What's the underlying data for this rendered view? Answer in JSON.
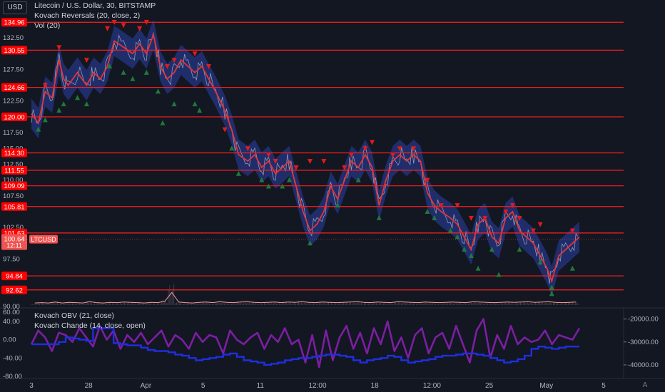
{
  "header": {
    "currency_button": "USD",
    "title": "Litecoin / U.S. Dollar, 30, BITSTAMP",
    "indicator_1": "Kovach Reversals (20, close, 2)",
    "indicator_2": "Vol (20)",
    "lower_indicator_1": "Kovach OBV (21, close)",
    "lower_indicator_2": "Kovach Chande (14, close, open)",
    "auto_button": "A"
  },
  "colors": {
    "background": "#131722",
    "level_line": "#ff1e1e",
    "level_label_bg": "#ff0000",
    "band": "#2a3fa8",
    "ma_line": "#e0363c",
    "price": "#b2b5be",
    "up_marker": "#1e7a3a",
    "down_marker": "#e01b1b",
    "chande": "#7b1fa2",
    "obv": "#1f2fe0",
    "price_label_bg": "#f05350"
  },
  "chart_data": [
    {
      "type": "line",
      "symbol": "LTCUSD",
      "last_price": "100.64",
      "countdown": "12:11",
      "x_tick_labels": [
        "3",
        "28",
        "Apr",
        "5",
        "11",
        "12:00",
        "18",
        "12:00",
        "25",
        "May",
        "5"
      ],
      "y_tick_labels": [
        "132.50",
        "127.50",
        "122.50",
        "117.50",
        "115.00",
        "112.50",
        "110.00",
        "107.50",
        "102.50",
        "97.50",
        "90.00"
      ],
      "ylim": [
        90,
        136
      ],
      "levels": [
        "134.96",
        "130.55",
        "124.66",
        "120.00",
        "114.30",
        "111.55",
        "109.09",
        "105.81",
        "101.63",
        "94.84",
        "92.62"
      ],
      "price_path": [
        [
          0,
          120.5
        ],
        [
          3,
          119
        ],
        [
          6,
          124
        ],
        [
          9,
          123
        ],
        [
          12,
          129
        ],
        [
          14,
          126
        ],
        [
          16,
          125
        ],
        [
          20,
          127
        ],
        [
          24,
          125
        ],
        [
          27,
          127
        ],
        [
          30,
          126
        ],
        [
          33,
          128
        ],
        [
          36,
          132
        ],
        [
          40,
          131
        ],
        [
          44,
          130
        ],
        [
          47,
          131.5
        ],
        [
          50,
          130
        ],
        [
          53,
          133
        ],
        [
          56,
          128
        ],
        [
          59,
          126
        ],
        [
          62,
          127
        ],
        [
          65,
          129
        ],
        [
          68,
          128
        ],
        [
          71,
          127
        ],
        [
          74,
          128
        ],
        [
          77,
          126
        ],
        [
          80,
          124
        ],
        [
          84,
          121
        ],
        [
          87,
          118
        ],
        [
          90,
          114
        ],
        [
          94,
          113
        ],
        [
          97,
          114
        ],
        [
          100,
          112
        ],
        [
          103,
          113
        ],
        [
          106,
          111
        ],
        [
          109,
          112
        ],
        [
          112,
          113
        ],
        [
          115,
          109
        ],
        [
          118,
          105
        ],
        [
          121,
          102
        ],
        [
          124,
          103
        ],
        [
          127,
          105
        ],
        [
          130,
          109
        ],
        [
          133,
          107
        ],
        [
          136,
          110
        ],
        [
          139,
          113
        ],
        [
          142,
          112
        ],
        [
          145,
          114
        ],
        [
          148,
          112
        ],
        [
          151,
          106
        ],
        [
          154,
          110
        ],
        [
          157,
          113
        ],
        [
          160,
          114
        ],
        [
          163,
          113
        ],
        [
          166,
          114
        ],
        [
          169,
          113
        ],
        [
          172,
          108
        ],
        [
          175,
          106
        ],
        [
          178,
          105
        ],
        [
          182,
          104
        ],
        [
          185,
          103
        ],
        [
          188,
          101
        ],
        [
          191,
          99
        ],
        [
          194,
          103
        ],
        [
          197,
          104
        ],
        [
          200,
          101
        ],
        [
          203,
          100
        ],
        [
          206,
          104
        ],
        [
          209,
          105
        ],
        [
          212,
          102
        ],
        [
          215,
          101
        ],
        [
          218,
          100
        ],
        [
          221,
          98
        ],
        [
          224,
          96
        ],
        [
          226,
          94
        ],
        [
          229,
          98
        ],
        [
          232,
          99
        ],
        [
          235,
          100
        ],
        [
          238,
          101
        ]
      ],
      "band_offset": 2.4,
      "up_markers": [
        [
          3,
          118
        ],
        [
          6,
          119.5
        ],
        [
          12,
          121
        ],
        [
          14,
          122
        ],
        [
          20,
          123
        ],
        [
          24,
          122
        ],
        [
          34,
          128
        ],
        [
          40,
          127
        ],
        [
          44,
          126
        ],
        [
          50,
          127
        ],
        [
          55,
          124
        ],
        [
          57,
          119
        ],
        [
          62,
          122
        ],
        [
          71,
          122
        ],
        [
          73,
          121
        ],
        [
          87,
          115
        ],
        [
          90,
          111
        ],
        [
          100,
          110
        ],
        [
          103,
          109
        ],
        [
          109,
          109
        ],
        [
          112,
          110
        ],
        [
          121,
          100
        ],
        [
          133,
          106
        ],
        [
          142,
          110
        ],
        [
          151,
          104
        ],
        [
          172,
          105
        ],
        [
          175,
          104
        ],
        [
          182,
          102
        ],
        [
          185,
          101
        ],
        [
          188,
          99
        ],
        [
          191,
          98
        ],
        [
          194,
          96
        ],
        [
          200,
          99
        ],
        [
          203,
          95
        ],
        [
          212,
          99
        ],
        [
          221,
          97
        ],
        [
          226,
          93
        ],
        [
          226,
          92
        ],
        [
          235,
          96
        ]
      ],
      "down_markers": [
        [
          6,
          125
        ],
        [
          12,
          131
        ],
        [
          24,
          129
        ],
        [
          33,
          134
        ],
        [
          36,
          135
        ],
        [
          40,
          134.5
        ],
        [
          47,
          134
        ],
        [
          50,
          135
        ],
        [
          59,
          128
        ],
        [
          62,
          129
        ],
        [
          71,
          130
        ],
        [
          77,
          128
        ],
        [
          84,
          118
        ],
        [
          94,
          115
        ],
        [
          103,
          114
        ],
        [
          106,
          113
        ],
        [
          115,
          112
        ],
        [
          121,
          113
        ],
        [
          127,
          113
        ],
        [
          136,
          112
        ],
        [
          139,
          114
        ],
        [
          145,
          115
        ],
        [
          148,
          116
        ],
        [
          157,
          114
        ],
        [
          160,
          115
        ],
        [
          166,
          115
        ],
        [
          172,
          110
        ],
        [
          178,
          106
        ],
        [
          185,
          106
        ],
        [
          191,
          104
        ],
        [
          197,
          104
        ],
        [
          206,
          105
        ],
        [
          209,
          106
        ],
        [
          212,
          104
        ],
        [
          218,
          102
        ],
        [
          221,
          103
        ],
        [
          235,
          102
        ]
      ],
      "volume": [
        0.02,
        0.03,
        0.02,
        0.05,
        0.02,
        0.04,
        0.03,
        0.02,
        0.06,
        0.03,
        0.02,
        0.04,
        0.03,
        0.05,
        0.04,
        0.03,
        0.02,
        0.04,
        0.03,
        0.08,
        0.35,
        0.05,
        0.03,
        0.02,
        0.04,
        0.05,
        0.03,
        0.06,
        0.04,
        0.03,
        0.05,
        0.06,
        0.04,
        0.03,
        0.04,
        0.05,
        0.03,
        0.05,
        0.04,
        0.06,
        0.04,
        0.03,
        0.05,
        0.04,
        0.03,
        0.04,
        0.05,
        0.06,
        0.04,
        0.03,
        0.05,
        0.04,
        0.03,
        0.06,
        0.05,
        0.04,
        0.03,
        0.05,
        0.04,
        0.03,
        0.04,
        0.05,
        0.04,
        0.03,
        0.06,
        0.05,
        0.04,
        0.03,
        0.04,
        0.05,
        0.04,
        0.05,
        0.06,
        0.04,
        0.05,
        0.06,
        0.04,
        0.03,
        0.04,
        0.05
      ],
      "volume_spike_labels": []
    },
    {
      "type": "line",
      "left_y_tick_labels": [
        "60.00",
        "40.00",
        "0.00",
        "-40.00",
        "-80.00"
      ],
      "right_y_tick_labels": [
        "-20000.00",
        "-30000.00",
        "-40000.00"
      ],
      "left_ylim": [
        -80,
        60
      ],
      "right_ylim": [
        -45000,
        -17000
      ],
      "series": [
        {
          "name": "Kovach Chande (14, close, open)",
          "values": [
            -10,
            20,
            5,
            -25,
            15,
            10,
            -5,
            25,
            5,
            -15,
            30,
            0,
            20,
            -20,
            10,
            -5,
            15,
            -10,
            5,
            20,
            -15,
            10,
            0,
            -20,
            15,
            -5,
            10,
            5,
            -30,
            20,
            0,
            -10,
            5,
            15,
            -20,
            10,
            -5,
            25,
            -10,
            0,
            -50,
            10,
            -60,
            20,
            -45,
            5,
            30,
            -20,
            15,
            -30,
            25,
            -10,
            40,
            -25,
            5,
            -40,
            10,
            25,
            -30,
            5,
            15,
            -20,
            30,
            -10,
            -50,
            20,
            45,
            -40,
            10,
            -20,
            30,
            -10,
            5,
            -5,
            0,
            20,
            -10,
            10,
            5,
            0,
            25
          ]
        },
        {
          "name": "Kovach OBV (21, close)",
          "values": [
            -31000,
            -31000,
            -31000,
            -31000,
            -30000,
            -28000,
            -28500,
            -29000,
            -29500,
            -24000,
            -24000,
            -24000,
            -30500,
            -31000,
            -31500,
            -31500,
            -32500,
            -33500,
            -34000,
            -34000,
            -34500,
            -35500,
            -36000,
            -37000,
            -38000,
            -37500,
            -37000,
            -36500,
            -35500,
            -35000,
            -36500,
            -38000,
            -38500,
            -39000,
            -40000,
            -39500,
            -39000,
            -38000,
            -37500,
            -37000,
            -37000,
            -36500,
            -36000,
            -35500,
            -35500,
            -36000,
            -36500,
            -38000,
            -39000,
            -38000,
            -37500,
            -37000,
            -36000,
            -36500,
            -38000,
            -39000,
            -38500,
            -38000,
            -37500,
            -36500,
            -36000,
            -36000,
            -35500,
            -35000,
            -35000,
            -35500,
            -36000,
            -37000,
            -38000,
            -39000,
            -38500,
            -37500,
            -36000,
            -33000,
            -32000,
            -32500,
            -33000,
            -32500,
            -32000,
            -32000,
            -32000
          ]
        }
      ]
    }
  ]
}
